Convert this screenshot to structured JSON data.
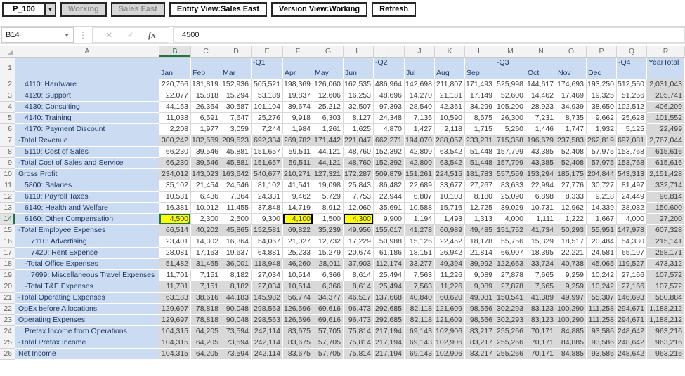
{
  "pov": {
    "page_button": "P_100",
    "dropdown_arrow": "▼",
    "working_button": "Working",
    "sales_east_button": "Sales East",
    "entity_view_button": "Entity View:Sales East",
    "version_view_button": "Version View:Working",
    "refresh_button": "Refresh"
  },
  "formula_bar": {
    "name_box": "B14",
    "name_box_arrow": "▼",
    "dots": "⋮",
    "cancel_icon": "✕",
    "enter_icon": "✓",
    "fx_icon": "fx",
    "value": "4500"
  },
  "colors": {
    "member_blue": "#cbdcf2",
    "readonly_gray": "#d9d9d9",
    "dirty_yellow": "#ffff00",
    "selection_green": "#217346",
    "label_text": "#1f3864"
  },
  "grid": {
    "columns": [
      "A",
      "B",
      "C",
      "D",
      "E",
      "F",
      "G",
      "H",
      "I",
      "J",
      "K",
      "L",
      "M",
      "N",
      "O",
      "P",
      "Q",
      "R"
    ],
    "header_top": [
      "",
      "",
      "",
      "-Q1",
      "",
      "",
      "",
      "-Q2",
      "",
      "",
      "",
      "-Q3",
      "",
      "",
      "",
      "-Q4",
      "YearTotal"
    ],
    "header_bottom": [
      "Jan",
      "Feb",
      "Mar",
      "",
      "Apr",
      "May",
      "Jun",
      "",
      "Jul",
      "Aug",
      "Sep",
      "",
      "Oct",
      "Nov",
      "Dec",
      "",
      ""
    ],
    "selected_column": "B",
    "selected_row": 14,
    "selected_cell": "B14",
    "dirty_cells": [
      "B14",
      "F14",
      "H14"
    ],
    "gray_rows": [
      7,
      9,
      10,
      15,
      18,
      20,
      21,
      22,
      23,
      24,
      25,
      26
    ],
    "gray_columns": [
      "R"
    ],
    "rows": [
      {
        "num": 2,
        "label": "4110: Hardware",
        "indent": 1,
        "values": [
          "220,766",
          "131,819",
          "152,936",
          "505,521",
          "198,369",
          "126,060",
          "162,535",
          "486,964",
          "142,698",
          "211,807",
          "171,493",
          "525,998",
          "144,617",
          "174,693",
          "193,250",
          "512,560",
          "2,031,043"
        ]
      },
      {
        "num": 3,
        "label": "4120: Support",
        "indent": 1,
        "values": [
          "22,077",
          "15,818",
          "15,294",
          "53,189",
          "19,837",
          "12,606",
          "16,253",
          "48,696",
          "14,270",
          "21,181",
          "17,149",
          "52,600",
          "14,462",
          "17,469",
          "19,325",
          "51,256",
          "205,741"
        ]
      },
      {
        "num": 4,
        "label": "4130: Consulting",
        "indent": 1,
        "values": [
          "44,153",
          "26,364",
          "30,587",
          "101,104",
          "39,674",
          "25,212",
          "32,507",
          "97,393",
          "28,540",
          "42,361",
          "34,299",
          "105,200",
          "28,923",
          "34,939",
          "38,650",
          "102,512",
          "406,209"
        ]
      },
      {
        "num": 5,
        "label": "4140: Training",
        "indent": 1,
        "values": [
          "11,038",
          "6,591",
          "7,647",
          "25,276",
          "9,918",
          "6,303",
          "8,127",
          "24,348",
          "7,135",
          "10,590",
          "8,575",
          "26,300",
          "7,231",
          "8,735",
          "9,662",
          "25,628",
          "101,552"
        ]
      },
      {
        "num": 6,
        "label": "4170: Payment Discount",
        "indent": 1,
        "values": [
          "2,208",
          "1,977",
          "3,059",
          "7,244",
          "1,984",
          "1,261",
          "1,625",
          "4,870",
          "1,427",
          "2,118",
          "1,715",
          "5,260",
          "1,446",
          "1,747",
          "1,932",
          "5,125",
          "22,499"
        ]
      },
      {
        "num": 7,
        "label": "-Total Revenue",
        "indent": 0,
        "values": [
          "300,242",
          "182,569",
          "209,523",
          "692,334",
          "269,782",
          "171,442",
          "221,047",
          "662,271",
          "194,070",
          "288,057",
          "233,231",
          "715,358",
          "196,679",
          "237,583",
          "262,819",
          "697,081",
          "2,767,044"
        ]
      },
      {
        "num": 8,
        "label": "5110: Cost of Sales",
        "indent": 1,
        "values": [
          "66,230",
          "39,546",
          "45,881",
          "151,657",
          "59,511",
          "44,121",
          "48,760",
          "152,392",
          "42,809",
          "63,542",
          "51,448",
          "157,799",
          "43,385",
          "52,408",
          "57,975",
          "153,768",
          "615,616"
        ]
      },
      {
        "num": 9,
        "label": "-Total Cost of Sales and Service",
        "indent": 0,
        "values": [
          "66,230",
          "39,546",
          "45,881",
          "151,657",
          "59,511",
          "44,121",
          "48,760",
          "152,392",
          "42,809",
          "63,542",
          "51,448",
          "157,799",
          "43,385",
          "52,408",
          "57,975",
          "153,768",
          "615,616"
        ]
      },
      {
        "num": 10,
        "label": "Gross Profit",
        "indent": 0,
        "values": [
          "234,012",
          "143,023",
          "163,642",
          "540,677",
          "210,271",
          "127,321",
          "172,287",
          "509,879",
          "151,261",
          "224,515",
          "181,783",
          "557,559",
          "153,294",
          "185,175",
          "204,844",
          "543,313",
          "2,151,428"
        ]
      },
      {
        "num": 11,
        "label": "5800: Salaries",
        "indent": 1,
        "values": [
          "35,102",
          "21,454",
          "24,546",
          "81,102",
          "41,541",
          "19,098",
          "25,843",
          "86,482",
          "22,689",
          "33,677",
          "27,267",
          "83,633",
          "22,994",
          "27,776",
          "30,727",
          "81,497",
          "332,714"
        ]
      },
      {
        "num": 12,
        "label": "6110: Payroll Taxes",
        "indent": 1,
        "values": [
          "10,531",
          "6,436",
          "7,364",
          "24,331",
          "9,462",
          "5,729",
          "7,753",
          "22,944",
          "6,807",
          "10,103",
          "8,180",
          "25,090",
          "6,898",
          "8,333",
          "9,218",
          "24,449",
          "96,814"
        ]
      },
      {
        "num": 13,
        "label": "6140: Health and Welfare",
        "indent": 1,
        "values": [
          "16,381",
          "10,012",
          "11,455",
          "37,848",
          "14,719",
          "8,912",
          "12,060",
          "35,691",
          "10,588",
          "15,716",
          "12,725",
          "39,029",
          "10,731",
          "12,962",
          "14,339",
          "38,032",
          "150,600"
        ]
      },
      {
        "num": 14,
        "label": "6160: Other Compensation",
        "indent": 1,
        "values": [
          "4,500",
          "2,300",
          "2,500",
          "9,300",
          "4,100",
          "1,500",
          "4,300",
          "9,900",
          "1,194",
          "1,493",
          "1,313",
          "4,000",
          "1,111",
          "1,222",
          "1,667",
          "4,000",
          "27,200"
        ]
      },
      {
        "num": 15,
        "label": "-Total Employee Expenses",
        "indent": 0,
        "values": [
          "66,514",
          "40,202",
          "45,865",
          "152,581",
          "69,822",
          "35,239",
          "49,956",
          "155,017",
          "41,278",
          "60,989",
          "49,485",
          "151,752",
          "41,734",
          "50,293",
          "55,951",
          "147,978",
          "607,328"
        ]
      },
      {
        "num": 16,
        "label": "7110: Advertising",
        "indent": 2,
        "values": [
          "23,401",
          "14,302",
          "16,364",
          "54,067",
          "21,027",
          "12,732",
          "17,229",
          "50,988",
          "15,126",
          "22,452",
          "18,178",
          "55,756",
          "15,329",
          "18,517",
          "20,484",
          "54,330",
          "215,141"
        ]
      },
      {
        "num": 17,
        "label": "7420: Rent Expense",
        "indent": 2,
        "values": [
          "28,081",
          "17,163",
          "19,637",
          "64,881",
          "25,233",
          "15,279",
          "20,674",
          "61,186",
          "18,151",
          "26,942",
          "21,814",
          "66,907",
          "18,395",
          "22,221",
          "24,581",
          "65,197",
          "258,171"
        ]
      },
      {
        "num": 18,
        "label": "-Total Office Expenses",
        "indent": 1,
        "values": [
          "51,482",
          "31,465",
          "36,001",
          "118,948",
          "46,260",
          "28,011",
          "37,903",
          "112,174",
          "33,277",
          "49,394",
          "39,992",
          "122,663",
          "33,724",
          "40,738",
          "45,065",
          "119,527",
          "473,312"
        ]
      },
      {
        "num": 19,
        "label": "7699: Miscellaneous Travel Expenses",
        "indent": 2,
        "values": [
          "11,701",
          "7,151",
          "8,182",
          "27,034",
          "10,514",
          "6,366",
          "8,614",
          "25,494",
          "7,563",
          "11,226",
          "9,089",
          "27,878",
          "7,665",
          "9,259",
          "10,242",
          "27,166",
          "107,572"
        ]
      },
      {
        "num": 20,
        "label": "-Total T&E Expenses",
        "indent": 1,
        "values": [
          "11,701",
          "7,151",
          "8,182",
          "27,034",
          "10,514",
          "6,366",
          "8,614",
          "25,494",
          "7,563",
          "11,226",
          "9,089",
          "27,878",
          "7,665",
          "9,259",
          "10,242",
          "27,166",
          "107,572"
        ]
      },
      {
        "num": 21,
        "label": "-Total Operating Expenses",
        "indent": 0,
        "values": [
          "63,183",
          "38,616",
          "44,183",
          "145,982",
          "56,774",
          "34,377",
          "46,517",
          "137,668",
          "40,840",
          "60,620",
          "49,081",
          "150,541",
          "41,389",
          "49,997",
          "55,307",
          "146,693",
          "580,884"
        ]
      },
      {
        "num": 22,
        "label": "OpEx before Allocations",
        "indent": 0,
        "values": [
          "129,697",
          "78,818",
          "90,048",
          "298,563",
          "126,596",
          "69,616",
          "96,473",
          "292,685",
          "82,118",
          "121,609",
          "98,566",
          "302,293",
          "83,123",
          "100,290",
          "111,258",
          "294,671",
          "1,188,212"
        ]
      },
      {
        "num": 23,
        "label": "Operating Expenses",
        "indent": 0,
        "values": [
          "129,697",
          "78,818",
          "90,048",
          "298,563",
          "126,596",
          "69,616",
          "96,473",
          "292,685",
          "82,118",
          "121,609",
          "98,566",
          "302,293",
          "83,123",
          "100,290",
          "111,258",
          "294,671",
          "1,188,212"
        ]
      },
      {
        "num": 24,
        "label": "Pretax Income from Operations",
        "indent": 1,
        "values": [
          "104,315",
          "64,205",
          "73,594",
          "242,114",
          "83,675",
          "57,705",
          "75,814",
          "217,194",
          "69,143",
          "102,906",
          "83,217",
          "255,266",
          "70,171",
          "84,885",
          "93,586",
          "248,642",
          "963,216"
        ]
      },
      {
        "num": 25,
        "label": "-Total Pretax Income",
        "indent": 0,
        "values": [
          "104,315",
          "64,205",
          "73,594",
          "242,114",
          "83,675",
          "57,705",
          "75,814",
          "217,194",
          "69,143",
          "102,906",
          "83,217",
          "255,266",
          "70,171",
          "84,885",
          "93,586",
          "248,642",
          "963,216"
        ]
      },
      {
        "num": 26,
        "label": "Net Income",
        "indent": 0,
        "values": [
          "104,315",
          "64,205",
          "73,594",
          "242,114",
          "83,675",
          "57,705",
          "75,814",
          "217,194",
          "69,143",
          "102,906",
          "83,217",
          "255,266",
          "70,171",
          "84,885",
          "93,586",
          "248,642",
          "963,216"
        ]
      }
    ]
  }
}
